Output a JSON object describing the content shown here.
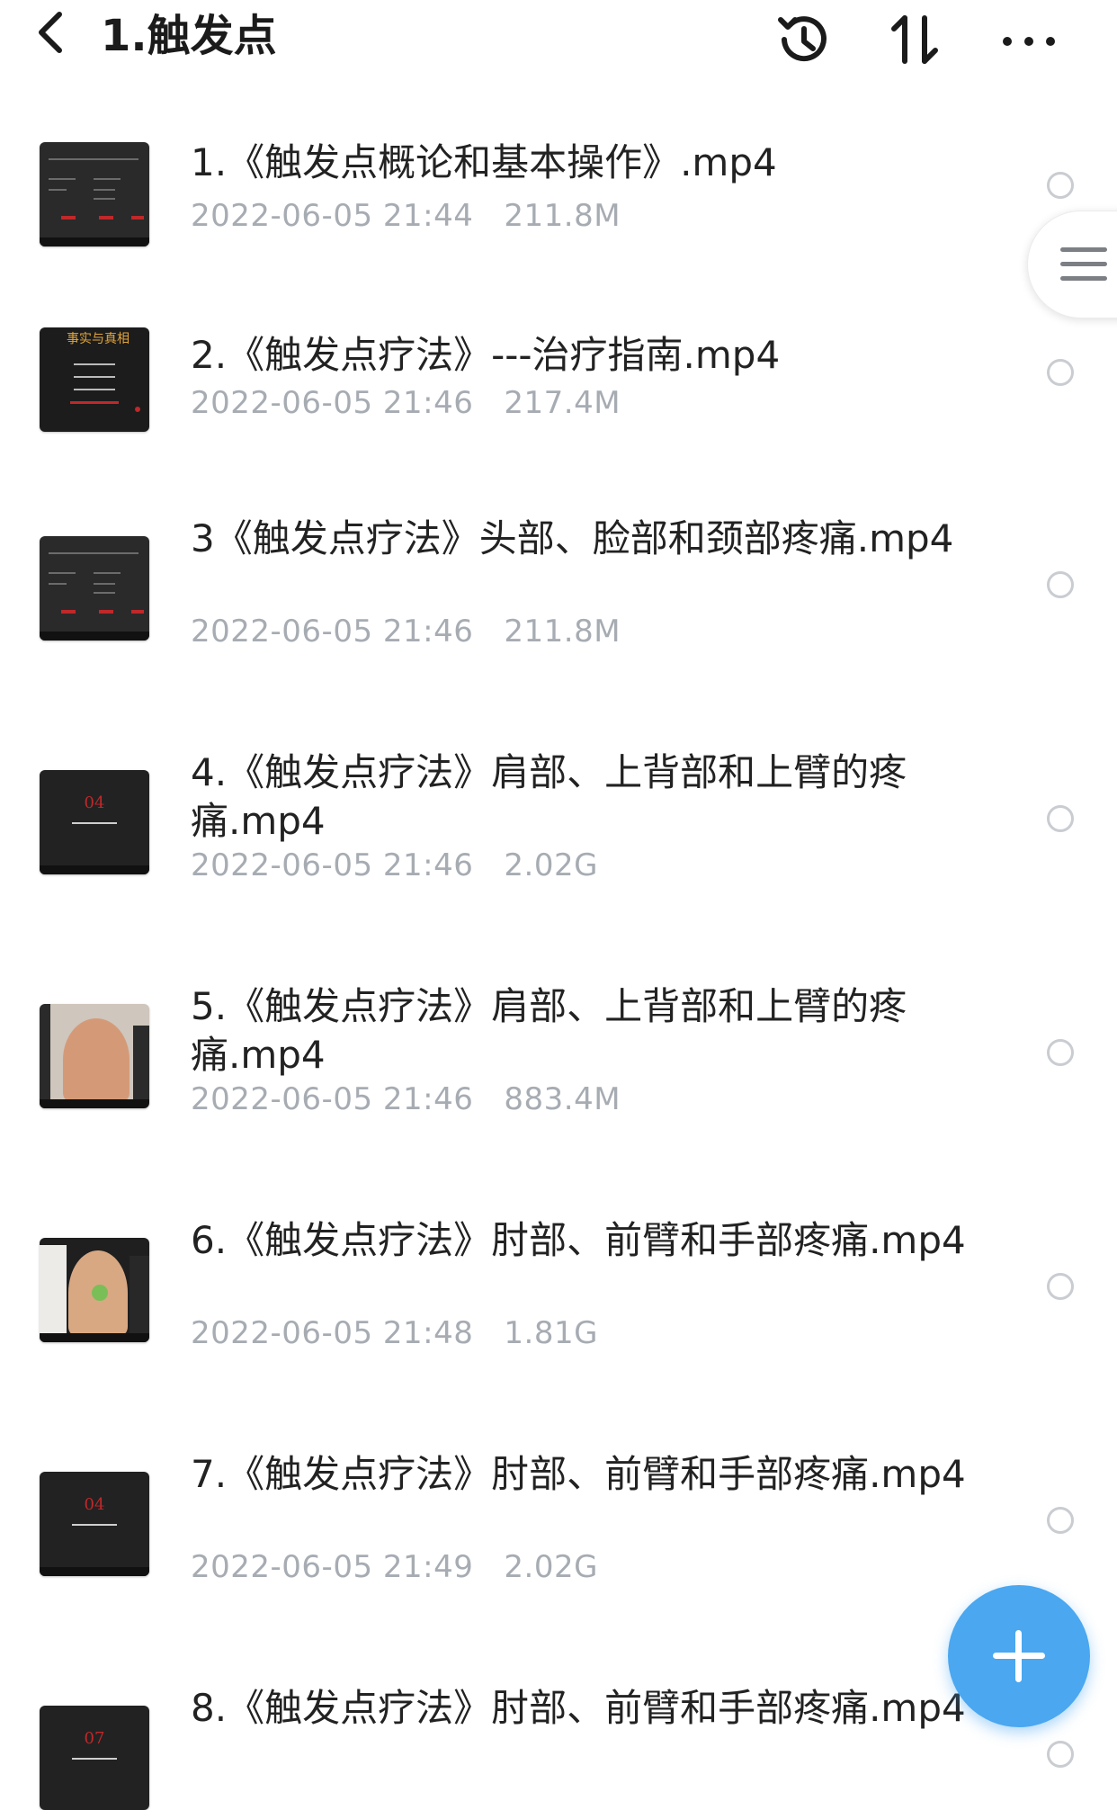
{
  "header": {
    "back_icon": "chevron-left-icon",
    "title": "1.触发点",
    "history_icon": "history-clock-icon",
    "sort_icon": "sort-arrows-icon",
    "more_icon": "more-dots-icon"
  },
  "files": [
    {
      "name": "1.《触发点概论和基本操作》.mp4",
      "date": "2022-06-05 21:44",
      "size": "211.8M"
    },
    {
      "name": "2.《触发点疗法》---治疗指南.mp4",
      "date": "2022-06-05 21:46",
      "size": "217.4M",
      "thumb_text_1": "事实与真相"
    },
    {
      "name": "3《触发点疗法》头部、脸部和颈部疼痛.mp4",
      "date": "2022-06-05 21:46",
      "size": "211.8M"
    },
    {
      "name": "4.《触发点疗法》肩部、上背部和上臂的疼痛.mp4",
      "date": "2022-06-05 21:46",
      "size": "2.02G",
      "thumb_text_1": "04"
    },
    {
      "name": "5.《触发点疗法》肩部、上背部和上臂的疼痛.mp4",
      "date": "2022-06-05 21:46",
      "size": "883.4M"
    },
    {
      "name": "6.《触发点疗法》肘部、前臂和手部疼痛.mp4",
      "date": "2022-06-05 21:48",
      "size": "1.81G"
    },
    {
      "name": "7.《触发点疗法》肘部、前臂和手部疼痛.mp4",
      "date": "2022-06-05 21:49",
      "size": "2.02G",
      "thumb_text_1": "04"
    },
    {
      "name": "8.《触发点疗法》肘部、前臂和手部疼痛.mp4",
      "date": "",
      "size": "",
      "thumb_text_1": "07"
    }
  ],
  "side_menu_icon": "hamburger-menu-icon",
  "fab_icon": "plus-icon",
  "colors": {
    "accent": "#4aa7f0",
    "meta_text": "#a7acb3",
    "thumb_red": "#c0282a"
  }
}
